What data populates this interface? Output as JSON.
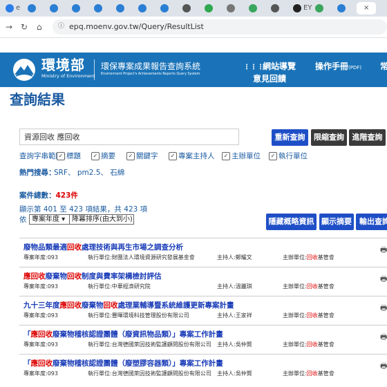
{
  "browser": {
    "tabs": [
      {
        "text": "e",
        "color": "#2b7de9"
      },
      {
        "text": "",
        "color": "#2a7fd4"
      },
      {
        "text": "",
        "color": "#2a7fd4"
      },
      {
        "text": "",
        "color": "#2a7fd4"
      },
      {
        "text": "",
        "color": "#2a7fd4"
      },
      {
        "text": "",
        "color": "#2a7fd4"
      },
      {
        "text": "",
        "color": "#2a7fd4"
      },
      {
        "text": "",
        "color": "#2a7fd4"
      },
      {
        "text": "",
        "color": "#555555"
      },
      {
        "text": "",
        "color": "#2fa84f"
      },
      {
        "text": "",
        "color": "#777777"
      },
      {
        "text": "",
        "color": "#3aa55c"
      },
      {
        "text": "",
        "color": "#555555"
      },
      {
        "text": "EY",
        "color": "#222222"
      },
      {
        "text": "",
        "color": "#3aa55c"
      },
      {
        "text": "",
        "color": "#2a7fd4"
      },
      {
        "text": "×",
        "color": "#ffffff"
      }
    ],
    "url": "epq.moenv.gov.tw/Query/ResultList"
  },
  "header": {
    "brand_title": "環境部",
    "brand_sub": "Ministry of Environment",
    "system_title": "環保專案成果報告查詢系統",
    "system_sub": "Environment Project's Achievements Reports Query System",
    "nav_sitemap": "網站導覽",
    "nav_manual": "操作手冊",
    "nav_manual_note": "(PDF)",
    "nav_feedback": "意見回饋",
    "nav_more": "常"
  },
  "page_title": "查詢結果",
  "search": {
    "value": "資源回收 應回收",
    "btn_requery": "重新查詢",
    "btn_refine": "限縮查詢",
    "btn_advanced": "進階查詢"
  },
  "scope": {
    "label": "查詢字串範圍：",
    "options": [
      "標題",
      "摘要",
      "關鍵字",
      "專案主持人",
      "主辦單位",
      "執行單位"
    ]
  },
  "hot": {
    "label": "熱門搜尋：",
    "items": "SRF、 pm2.5、 石綿"
  },
  "summary": {
    "total_label": "案件總數：",
    "total_value": "423件",
    "range_text": "顯示第 401 至 423 項結果，共 423 項",
    "sort_by": "依",
    "sort_field": "專案年度",
    "sort_order": "降冪排序(由大到小)",
    "btn_hide": "隱藏概略資訊",
    "btn_abstract": "顯示摘要",
    "btn_export": "輸出查詢"
  },
  "results": [
    {
      "title_parts": [
        [
          "廢物品類最適",
          0
        ],
        [
          "回收",
          1
        ],
        [
          "處理技術與再生市場之調查分析",
          0
        ]
      ],
      "year": "專案年度:093",
      "executor": "執行單位:財團法人環境資源研究發展基金會",
      "pi": "主持人:鄭耀文",
      "host_parts": [
        [
          "主辦單位:",
          0
        ],
        [
          "回收",
          1
        ],
        [
          "基管會",
          0
        ]
      ]
    },
    {
      "title_parts": [
        [
          "應回收",
          1
        ],
        [
          "廢棄物",
          0
        ],
        [
          "回收",
          1
        ],
        [
          "制度與費率架構檢討評估",
          0
        ]
      ],
      "year": "專案年度:093",
      "executor": "執行單位:中華經濟研究院",
      "pi": "主持人:溫麗琪",
      "host_parts": [
        [
          "主辦單位:",
          0
        ],
        [
          "回收",
          1
        ],
        [
          "基管會",
          0
        ]
      ]
    },
    {
      "title_parts": [
        [
          "九十三年度",
          0
        ],
        [
          "應回收",
          1
        ],
        [
          "廢棄物",
          0
        ],
        [
          "回收",
          1
        ],
        [
          "處理業輔導暨系統維護更新專案計畫",
          0
        ]
      ],
      "year": "專案年度:093",
      "executor": "執行單位:豐暉環境科技管理股份有限公司",
      "pi": "主持人:王家祥",
      "host_parts": [
        [
          "主辦單位:",
          0
        ],
        [
          "回收",
          1
        ],
        [
          "基管會",
          0
        ]
      ]
    },
    {
      "title_parts": [
        [
          "「",
          0
        ],
        [
          "應回收",
          1
        ],
        [
          "廢棄物稽核認證團體（廢資訊物品類）」專案工作計畫",
          0
        ]
      ],
      "year": "專案年度:093",
      "executor": "執行單位:台灣德國萊因技術監護顧問股份有限公司",
      "pi": "主持人:吳仲賢",
      "host_parts": [
        [
          "主辦單位:",
          0
        ],
        [
          "回收",
          1
        ],
        [
          "基管會",
          0
        ]
      ]
    },
    {
      "title_parts": [
        [
          "「",
          0
        ],
        [
          "應回收",
          1
        ],
        [
          "廢棄物稽核認證團體（廢塑膠容器類）」專案工作計畫",
          0
        ]
      ],
      "year": "專案年度:093",
      "executor": "執行單位:台灣德國萊因技術監護顧問股份有限公司",
      "pi": "主持人:吳仲賢",
      "host_parts": [
        [
          "主辦單位:",
          0
        ],
        [
          "回收",
          1
        ],
        [
          "基管會",
          0
        ]
      ]
    }
  ]
}
